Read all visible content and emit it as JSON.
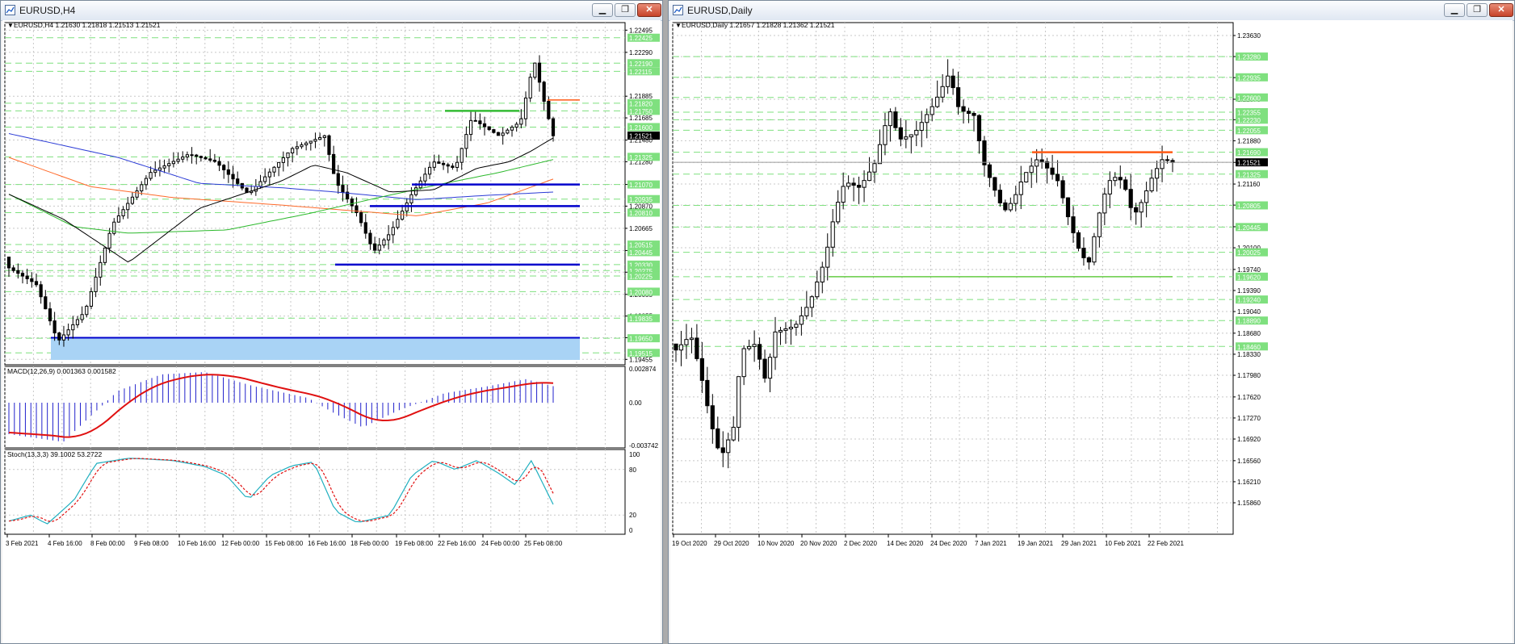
{
  "left": {
    "window_title": "EURUSD,H4",
    "header": "EURUSD,H4  1.21630 1.21818 1.21513 1.21521",
    "price_labels": [
      "1.22495",
      "1.22290",
      "1.21885",
      "1.21685",
      "1.21480",
      "1.21280",
      "1.21070",
      "1.20870",
      "1.20665",
      "1.20460",
      "1.20260",
      "1.20055",
      "1.19855",
      "1.19655",
      "1.19455"
    ],
    "level_labels": [
      "1.22425",
      "1.22190",
      "1.22115",
      "1.21820",
      "1.21750",
      "1.21600",
      "1.21325",
      "1.21070",
      "1.20935",
      "1.20810",
      "1.20515",
      "1.20445",
      "1.20330",
      "1.20275",
      "1.20225",
      "1.20080",
      "1.19835",
      "1.19650",
      "1.19515"
    ],
    "current_price": "1.21521",
    "macd_label": "MACD(12,26,9) 0.001363 0.001582",
    "macd_scale": [
      "0.002874",
      "0.00",
      "-0.003742"
    ],
    "stoch_label": "Stoch(13,3,3) 39.1002 53.2722",
    "stoch_scale": [
      "100",
      "80",
      "20",
      "0"
    ],
    "time_labels": [
      "3 Feb 2021",
      "4 Feb 16:00",
      "8 Feb 00:00",
      "9 Feb 08:00",
      "10 Feb 16:00",
      "12 Feb 00:00",
      "15 Feb 08:00",
      "16 Feb 16:00",
      "18 Feb 00:00",
      "19 Feb 08:00",
      "22 Feb 16:00",
      "24 Feb 00:00",
      "25 Feb 08:00"
    ]
  },
  "right": {
    "window_title": "EURUSD,Daily",
    "header": "EURUSD,Daily  1.21657 1.21828 1.21362 1.21521",
    "price_labels": [
      "1.23630",
      "1.23280",
      "1.22930",
      "1.22570",
      "1.22230",
      "1.21880",
      "1.21520",
      "1.21160",
      "1.20810",
      "1.20450",
      "1.20100",
      "1.19740",
      "1.19390",
      "1.19040",
      "1.18680",
      "1.18330",
      "1.17980",
      "1.17620",
      "1.17270",
      "1.16920",
      "1.16560",
      "1.16210",
      "1.15860"
    ],
    "level_labels": [
      "1.23280",
      "1.22935",
      "1.22600",
      "1.22355",
      "1.22230",
      "1.22055",
      "1.21690",
      "1.21325",
      "1.20805",
      "1.20445",
      "1.20025",
      "1.19620",
      "1.19240",
      "1.18890",
      "1.18460"
    ],
    "current_price": "1.21521",
    "time_labels": [
      "19 Oct 2020",
      "29 Oct 2020",
      "10 Nov 2020",
      "20 Nov 2020",
      "2 Dec 2020",
      "14 Dec 2020",
      "24 Dec 2020",
      "7 Jan 2021",
      "19 Jan 2021",
      "29 Jan 2021",
      "10 Feb 2021",
      "22 Feb 2021"
    ]
  },
  "colors": {
    "level_green": "#7fe07f",
    "grid": "#c8c8c8",
    "support_blue": "#0000cc",
    "resistance_orange": "#ff5a14",
    "macd_line": "#e01010",
    "macd_hist": "#2222cc",
    "sma_black": "#000000",
    "ma_blue": "#2b3bd6",
    "ma_orange": "#ff6a2a",
    "ma_green": "#2cb92c",
    "stoch_main": "#20b0c0",
    "stoch_signal": "#e01010"
  },
  "icons": [
    "window-icon",
    "minimize-icon",
    "restore-icon",
    "close-icon"
  ]
}
